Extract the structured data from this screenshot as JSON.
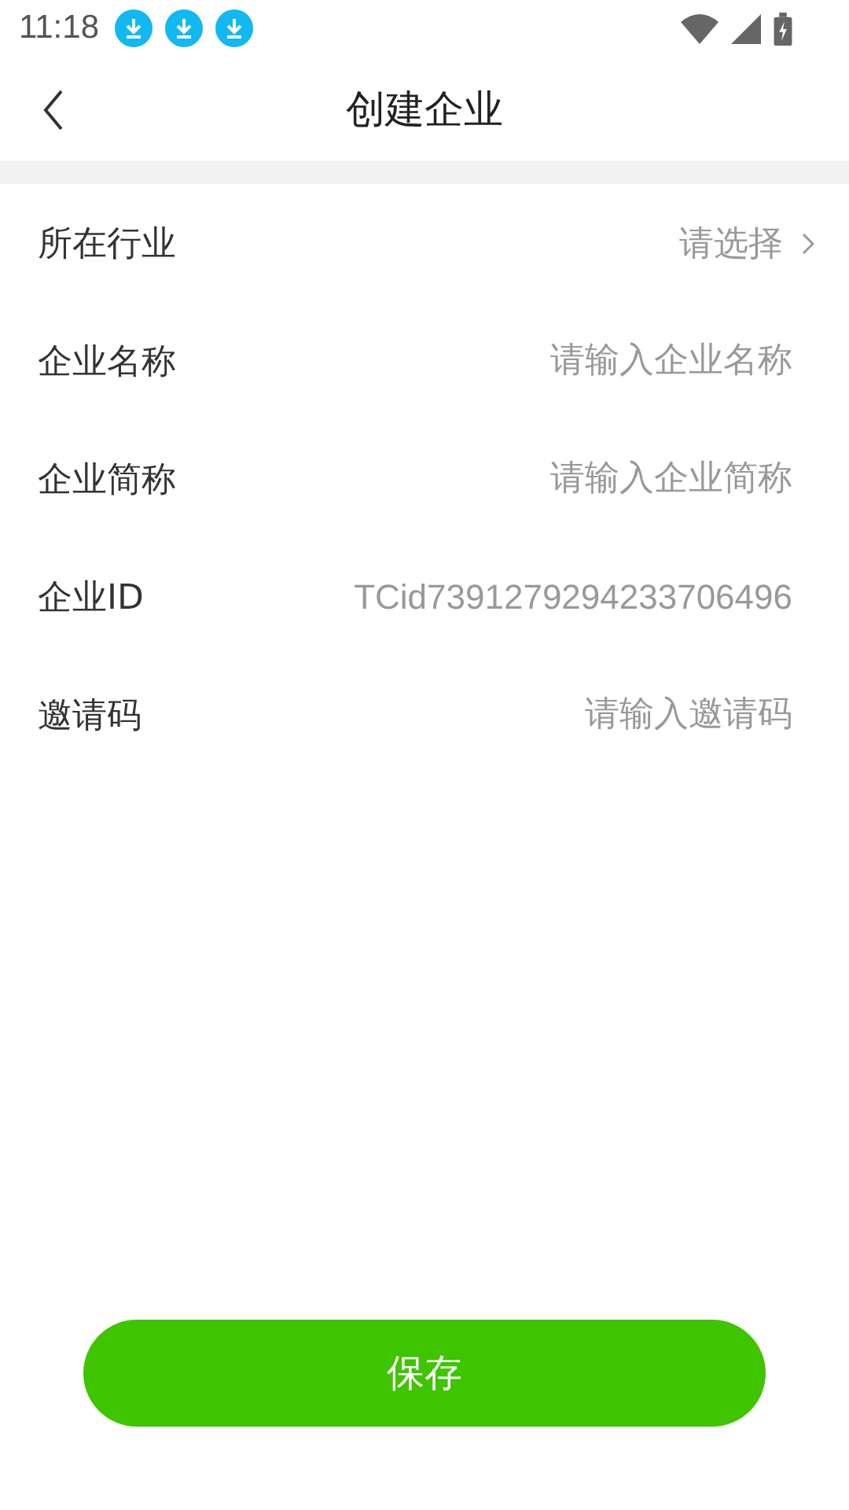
{
  "status_bar": {
    "time": "11:18",
    "notifications": [
      {
        "kind": "download"
      },
      {
        "kind": "download"
      },
      {
        "kind": "download"
      }
    ]
  },
  "header": {
    "title": "创建企业"
  },
  "form": {
    "rows": [
      {
        "kind": "select",
        "label": "所在行业",
        "placeholder": "请选择"
      },
      {
        "kind": "input",
        "label": "企业名称",
        "placeholder": "请输入企业名称"
      },
      {
        "kind": "input",
        "label": "企业简称",
        "placeholder": "请输入企业简称"
      },
      {
        "kind": "text",
        "label": "企业ID",
        "value": "TCid7391279294233706496"
      },
      {
        "kind": "input",
        "label": "邀请码",
        "placeholder": "请输入邀请码"
      }
    ]
  },
  "save_button": {
    "label": "保存"
  }
}
